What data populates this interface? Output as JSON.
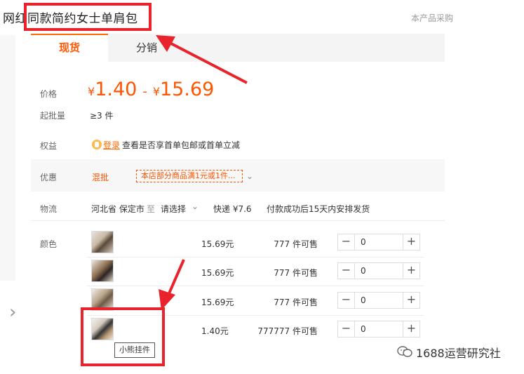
{
  "header": {
    "product_title": "网红同款简约女士单肩包",
    "top_right_text": "本产品采购"
  },
  "tabs": [
    "现货",
    "分销"
  ],
  "price": {
    "label": "价格",
    "currency": "¥",
    "min": "1.40",
    "separator": "-",
    "max": "15.69"
  },
  "moq": {
    "label": "起批量",
    "value": "≥3 件"
  },
  "benefits": {
    "label": "权益",
    "login_link": "登录",
    "text": "查看是否享首单包邮或首单立减"
  },
  "promotion": {
    "label": "优惠",
    "type": "混批",
    "tag": "本店部分商品满1元或1件..."
  },
  "logistics": {
    "label": "物流",
    "origin": "河北省 保定市",
    "to_word": "至",
    "destination": "请选择",
    "express": "快递 ¥7.6",
    "shipping_note": "付款成功后15天内安排发货"
  },
  "color": {
    "label": "颜色"
  },
  "variants": [
    {
      "price": "15.69元",
      "stock": "777 件可售",
      "qty": "0"
    },
    {
      "price": "15.69元",
      "stock": "777 件可售",
      "qty": "0"
    },
    {
      "price": "15.69元",
      "stock": "777 件可售",
      "qty": "0"
    },
    {
      "price": "1.40元",
      "stock": "777777 件可售",
      "qty": "0"
    }
  ],
  "stepper": {
    "minus": "−",
    "plus": "+"
  },
  "tooltip": "小熊挂件",
  "watermark": "1688运营研究社",
  "icons": {
    "prev_arrow": "chevron-left-icon",
    "dropdown": "chevron-down-icon",
    "login": "login-icon",
    "wechat": "wechat-icon"
  },
  "colors": {
    "accent": "#ff5400",
    "highlight": "#e8232c"
  }
}
